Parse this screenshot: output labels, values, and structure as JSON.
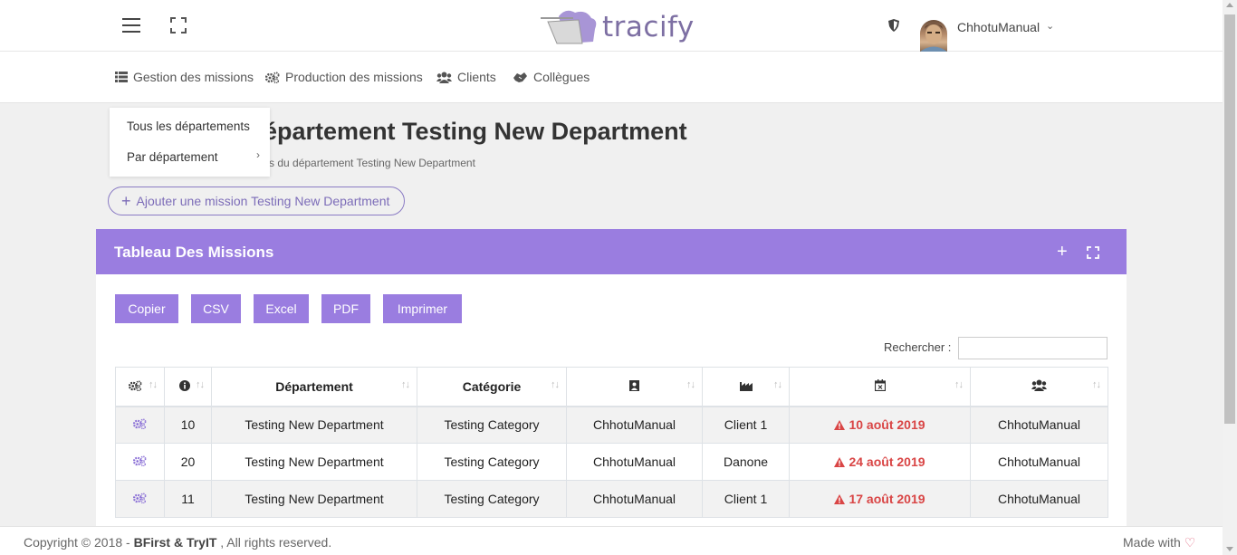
{
  "header": {
    "logo_text": "tracify",
    "username": "ChhotuManual"
  },
  "nav": {
    "items": [
      {
        "label": "Gestion des missions",
        "icon": "list-icon"
      },
      {
        "label": "Production des missions",
        "icon": "gears-icon"
      },
      {
        "label": "Clients",
        "icon": "users-icon"
      },
      {
        "label": "Collègues",
        "icon": "handshake-icon"
      }
    ],
    "dropdown": [
      "Tous les départements",
      "Par département"
    ]
  },
  "page": {
    "title": "épartement Testing New Department",
    "subtitle": "s du département Testing New Department",
    "add_button": "Ajouter une mission Testing New Department"
  },
  "card": {
    "title": "Tableau Des Missions",
    "export_buttons": [
      "Copier",
      "CSV",
      "Excel",
      "PDF",
      "Imprimer"
    ],
    "search_label": "Rechercher :"
  },
  "table": {
    "columns": [
      "",
      "",
      "Département",
      "Catégorie",
      "",
      "",
      "",
      ""
    ],
    "rows": [
      {
        "id": "10",
        "department": "Testing New Department",
        "category": "Testing Category",
        "owner": "ChhotuManual",
        "client": "Client 1",
        "date": "10 août 2019",
        "team": "ChhotuManual"
      },
      {
        "id": "20",
        "department": "Testing New Department",
        "category": "Testing Category",
        "owner": "ChhotuManual",
        "client": "Danone",
        "date": "24 août 2019",
        "team": "ChhotuManual"
      },
      {
        "id": "11",
        "department": "Testing New Department",
        "category": "Testing Category",
        "owner": "ChhotuManual",
        "client": "Client 1",
        "date": "17 août 2019",
        "team": "ChhotuManual"
      }
    ]
  },
  "footer": {
    "prefix": "Copyright © 2018 - ",
    "company": "BFirst & TryIT",
    "suffix": " , All rights reserved.",
    "made_with": "Made with"
  },
  "colors": {
    "accent": "#9a7de0",
    "date_red": "#d94545",
    "logo": "#7d6fa3"
  }
}
